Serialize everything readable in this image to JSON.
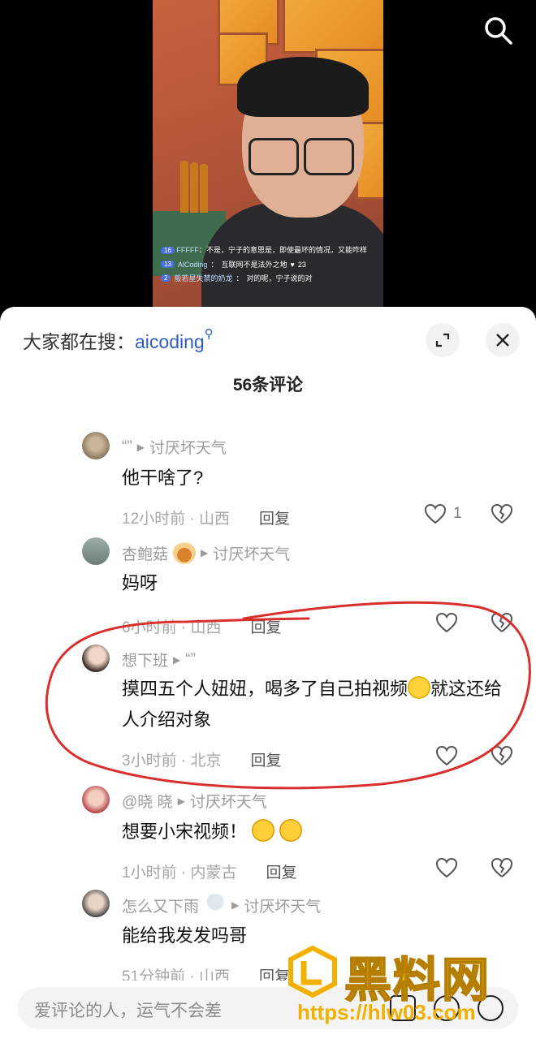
{
  "video": {
    "live_comments": [
      {
        "badge": "16",
        "name": "FFFFF",
        "text": "不是，宁子的意思是，即使最坏的情况，又能咋样"
      },
      {
        "badge": "13",
        "name": "AlCoding",
        "text": "互联网不是法外之地",
        "likes": "23"
      },
      {
        "badge": "2",
        "name": "般若星失禁的奶龙",
        "text": "对的呢，宁子说的对"
      }
    ]
  },
  "sheet": {
    "search_prefix": "大家都在搜：",
    "search_keyword": "aicoding",
    "comment_count": "56条评论"
  },
  "comments": [
    {
      "user": "“”",
      "reply_to": "讨厌坏天气",
      "text": "他干啥了?",
      "time_loc": "12小时前 · 山西",
      "reply": "回复",
      "likes": "1"
    },
    {
      "user": "杏鲍菇",
      "reply_to": "讨厌坏天气",
      "text": "妈呀",
      "time_loc": "6小时前 · 山西",
      "reply": "回复",
      "likes": ""
    },
    {
      "user": "想下班",
      "reply_to": "“”",
      "text": "摸四五个人妞妞，喝多了自己拍视频",
      "text_after_emoji": "就这还给人介绍对象",
      "time_loc": "3小时前 · 北京",
      "reply": "回复",
      "likes": ""
    },
    {
      "user": "@晓 晓",
      "reply_to": "讨厌坏天气",
      "text": "想要小宋视频！",
      "time_loc": "1小时前 · 内蒙古",
      "reply": "回复",
      "likes": ""
    },
    {
      "user": "怎么又下雨",
      "reply_to": "讨厌坏天气",
      "text": "能给我发发吗哥",
      "time_loc": "51分钟前 · 山西",
      "reply": "回复",
      "likes": ""
    }
  ],
  "input": {
    "placeholder": "爱评论的人，运气不会差"
  },
  "watermark": {
    "text": "黑料网",
    "url": "https://hlw03.com"
  }
}
